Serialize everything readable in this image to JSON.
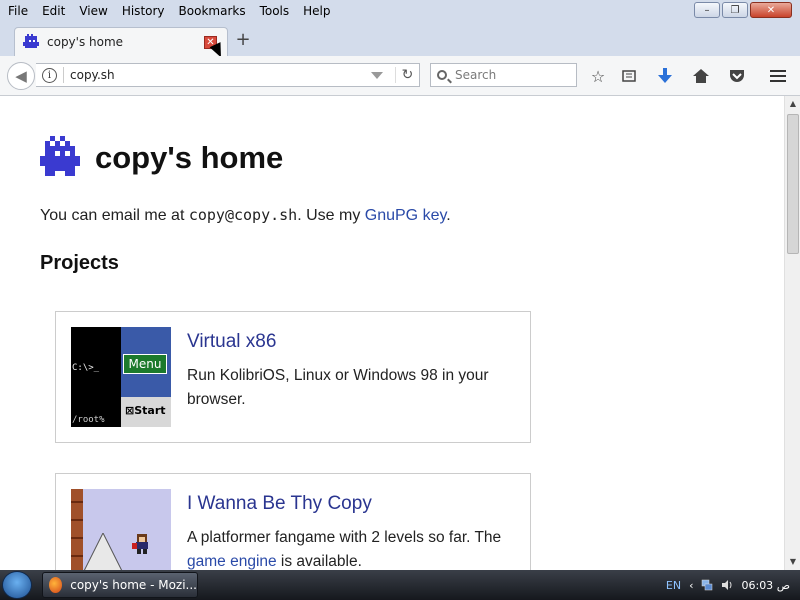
{
  "menu": [
    "File",
    "Edit",
    "View",
    "History",
    "Bookmarks",
    "Tools",
    "Help"
  ],
  "tab": {
    "title": "copy's home",
    "new_tab": "+"
  },
  "nav": {
    "url": "copy.sh",
    "search_placeholder": "Search"
  },
  "page": {
    "title": "copy's home",
    "email_prefix": "You can email me at ",
    "email": "copy@copy.sh",
    "email_mid": ". Use my ",
    "gpg_link": "GnuPG key",
    "email_end": ".",
    "projects_heading": "Projects",
    "projects": [
      {
        "title": "Virtual x86",
        "desc": "Run KolibriOS, Linux or Windows 98 in your browser.",
        "thumb": {
          "prompt": "C:\\>_",
          "menu": "Menu",
          "root": "/root%",
          "start": "Start"
        }
      },
      {
        "title": "I Wanna Be Thy Copy",
        "desc_before": "A platformer fangame with 2 levels so far. The ",
        "desc_link": "game engine",
        "desc_after": " is available."
      }
    ]
  },
  "taskbar": {
    "task_label": "copy's home - Mozi...",
    "lang": "EN",
    "clock": "06:03 ص"
  },
  "colors": {
    "link": "#2a4aa8",
    "card_title": "#2a3590",
    "logo": "#3a3ad0"
  }
}
